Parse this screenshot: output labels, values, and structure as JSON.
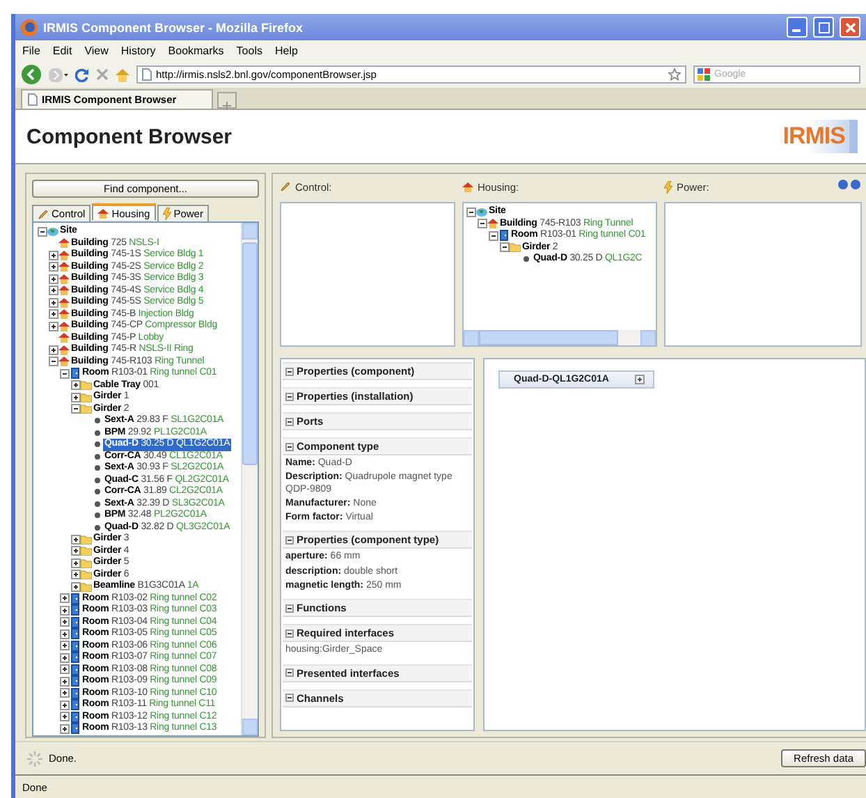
{
  "window": {
    "title": "IRMIS Component Browser - Mozilla Firefox"
  },
  "menu": [
    "File",
    "Edit",
    "View",
    "History",
    "Bookmarks",
    "Tools",
    "Help"
  ],
  "address_bar": {
    "url": "http://irmis.nsls2.bnl.gov/componentBrowser.jsp"
  },
  "search": {
    "placeholder": "Google"
  },
  "browser_tabs": [
    {
      "label": "IRMIS Component Browser",
      "selected": true
    }
  ],
  "page": {
    "title": "Component Browser",
    "logo": "IRMIS"
  },
  "find_button": "Find component...",
  "tree_tabs": [
    {
      "label": "Control",
      "kind": "control",
      "selected": false
    },
    {
      "label": "Housing",
      "kind": "housing",
      "selected": true
    },
    {
      "label": "Power",
      "kind": "power",
      "selected": false
    }
  ],
  "tree": [
    {
      "kind": "site",
      "type": "Site",
      "expanded": true,
      "selected": false,
      "children": [
        {
          "kind": "building",
          "type": "Building",
          "number": "725",
          "detail": "NSLS-I",
          "selected": false
        },
        {
          "kind": "building",
          "type": "Building",
          "number": "745-1S",
          "detail": "Service Bldg 1",
          "expanded": false,
          "selected": false
        },
        {
          "kind": "building",
          "type": "Building",
          "number": "745-2S",
          "detail": "Service Bdlg 2",
          "expanded": false,
          "selected": false
        },
        {
          "kind": "building",
          "type": "Building",
          "number": "745-3S",
          "detail": "Service Bdlg 3",
          "expanded": false,
          "selected": false
        },
        {
          "kind": "building",
          "type": "Building",
          "number": "745-4S",
          "detail": "Service Bdlg 4",
          "expanded": false,
          "selected": false
        },
        {
          "kind": "building",
          "type": "Building",
          "number": "745-5S",
          "detail": "Service Bdlg 5",
          "expanded": false,
          "selected": false
        },
        {
          "kind": "building",
          "type": "Building",
          "number": "745-B",
          "detail": "Injection Bldg",
          "expanded": false,
          "selected": false
        },
        {
          "kind": "building",
          "type": "Building",
          "number": "745-CP",
          "detail": "Compressor Bldg",
          "expanded": false,
          "selected": false
        },
        {
          "kind": "building",
          "type": "Building",
          "number": "745-P",
          "detail": "Lobby",
          "selected": false
        },
        {
          "kind": "building",
          "type": "Building",
          "number": "745-R",
          "detail": "NSLS-II Ring",
          "expanded": false,
          "selected": false
        },
        {
          "kind": "building",
          "type": "Building",
          "number": "745-R103",
          "detail": "Ring Tunnel",
          "expanded": true,
          "selected": false,
          "children": [
            {
              "kind": "room",
              "type": "Room",
              "number": "R103-01",
              "detail": "Ring tunnel C01",
              "expanded": true,
              "selected": false,
              "children": [
                {
                  "kind": "folder",
                  "type": "Cable Tray",
                  "number": "001",
                  "expanded": false,
                  "selected": false
                },
                {
                  "kind": "folder",
                  "type": "Girder",
                  "number": "1",
                  "expanded": false,
                  "selected": false
                },
                {
                  "kind": "folder",
                  "type": "Girder",
                  "number": "2",
                  "expanded": true,
                  "selected": false,
                  "children": [
                    {
                      "kind": "device",
                      "type": "Sext-A",
                      "number": "29.83 F",
                      "detail": "SL1G2C01A",
                      "selected": false
                    },
                    {
                      "kind": "device",
                      "type": "BPM",
                      "number": "29.92",
                      "detail": "PL1G2C01A",
                      "selected": false
                    },
                    {
                      "kind": "device",
                      "type": "Quad-D",
                      "number": "30.25 D",
                      "detail": "QL1G2C01A",
                      "selected": true
                    },
                    {
                      "kind": "device",
                      "type": "Corr-CA",
                      "number": "30.49",
                      "detail": "CL1G2C01A",
                      "selected": false
                    },
                    {
                      "kind": "device",
                      "type": "Sext-A",
                      "number": "30.93 F",
                      "detail": "SL2G2C01A",
                      "selected": false
                    },
                    {
                      "kind": "device",
                      "type": "Quad-C",
                      "number": "31.56 F",
                      "detail": "QL2G2C01A",
                      "selected": false
                    },
                    {
                      "kind": "device",
                      "type": "Corr-CA",
                      "number": "31.89",
                      "detail": "CL2G2C01A",
                      "selected": false
                    },
                    {
                      "kind": "device",
                      "type": "Sext-A",
                      "number": "32.39 D",
                      "detail": "SL3G2C01A",
                      "selected": false
                    },
                    {
                      "kind": "device",
                      "type": "BPM",
                      "number": "32.48",
                      "detail": "PL2G2C01A",
                      "selected": false
                    },
                    {
                      "kind": "device",
                      "type": "Quad-D",
                      "number": "32.82 D",
                      "detail": "QL3G2C01A",
                      "selected": false
                    }
                  ]
                },
                {
                  "kind": "folder",
                  "type": "Girder",
                  "number": "3",
                  "expanded": false,
                  "selected": false
                },
                {
                  "kind": "folder",
                  "type": "Girder",
                  "number": "4",
                  "expanded": false,
                  "selected": false
                },
                {
                  "kind": "folder",
                  "type": "Girder",
                  "number": "5",
                  "expanded": false,
                  "selected": false
                },
                {
                  "kind": "folder",
                  "type": "Girder",
                  "number": "6",
                  "expanded": false,
                  "selected": false
                },
                {
                  "kind": "folder",
                  "type": "Beamline",
                  "number": "B1G3C01A",
                  "detail": "1A",
                  "expanded": false,
                  "selected": false
                }
              ]
            },
            {
              "kind": "room",
              "type": "Room",
              "number": "R103-02",
              "detail": "Ring tunnel C02",
              "expanded": false,
              "selected": false
            },
            {
              "kind": "room",
              "type": "Room",
              "number": "R103-03",
              "detail": "Ring tunnel C03",
              "expanded": false,
              "selected": false
            },
            {
              "kind": "room",
              "type": "Room",
              "number": "R103-04",
              "detail": "Ring tunnel C04",
              "expanded": false,
              "selected": false
            },
            {
              "kind": "room",
              "type": "Room",
              "number": "R103-05",
              "detail": "Ring tunnel C05",
              "expanded": false,
              "selected": false
            },
            {
              "kind": "room",
              "type": "Room",
              "number": "R103-06",
              "detail": "Ring tunnel C06",
              "expanded": false,
              "selected": false
            },
            {
              "kind": "room",
              "type": "Room",
              "number": "R103-07",
              "detail": "Ring tunnel C07",
              "expanded": false,
              "selected": false
            },
            {
              "kind": "room",
              "type": "Room",
              "number": "R103-08",
              "detail": "Ring tunnel C08",
              "expanded": false,
              "selected": false
            },
            {
              "kind": "room",
              "type": "Room",
              "number": "R103-09",
              "detail": "Ring tunnel C09",
              "expanded": false,
              "selected": false
            },
            {
              "kind": "room",
              "type": "Room",
              "number": "R103-10",
              "detail": "Ring tunnel C10",
              "expanded": false,
              "selected": false
            },
            {
              "kind": "room",
              "type": "Room",
              "number": "R103-11",
              "detail": "Ring tunnel C11",
              "expanded": false,
              "selected": false
            },
            {
              "kind": "room",
              "type": "Room",
              "number": "R103-12",
              "detail": "Ring tunnel C12",
              "expanded": false,
              "selected": false
            },
            {
              "kind": "room",
              "type": "Room",
              "number": "R103-13",
              "detail": "Ring tunnel C13",
              "expanded": false,
              "selected": false
            }
          ]
        }
      ]
    }
  ],
  "panels": [
    {
      "kind": "control",
      "label": "Control:"
    },
    {
      "kind": "housing",
      "label": "Housing:"
    },
    {
      "kind": "power",
      "label": "Power:"
    }
  ],
  "housing_path": [
    {
      "kind": "site",
      "type": "Site",
      "expanded": true,
      "children": [
        {
          "kind": "building",
          "type": "Building",
          "number": "745-R103",
          "detail": "Ring Tunnel",
          "expanded": true,
          "children": [
            {
              "kind": "room",
              "type": "Room",
              "number": "R103-01",
              "detail": "Ring tunnel C01",
              "expanded": true,
              "children": [
                {
                  "kind": "folder",
                  "type": "Girder",
                  "number": "2",
                  "expanded": true,
                  "children": [
                    {
                      "kind": "device",
                      "type": "Quad-D",
                      "number": "30.25 D",
                      "detail": "QL1G2C"
                    }
                  ]
                }
              ]
            }
          ]
        }
      ]
    }
  ],
  "properties": [
    {
      "title": "Properties (component)",
      "expanded": true
    },
    {
      "title": "Properties (installation)",
      "expanded": true
    },
    {
      "title": "Ports",
      "expanded": true
    },
    {
      "title": "Component type",
      "expanded": true,
      "items": [
        {
          "label": "Name:",
          "value": "Quad-D"
        },
        {
          "label": "Description:",
          "value": "Quadrupole magnet type QDP-9809"
        },
        {
          "label": "Manufacturer:",
          "value": "None"
        },
        {
          "label": "Form factor:",
          "value": "Virtual"
        }
      ]
    },
    {
      "title": "Properties (component type)",
      "expanded": true,
      "items": [
        {
          "label": "aperture:",
          "value": "66 mm"
        },
        {
          "label": "description:",
          "value": "double short"
        },
        {
          "label": "magnetic length:",
          "value": "250 mm"
        }
      ]
    },
    {
      "title": "Functions",
      "expanded": true
    },
    {
      "title": "Required interfaces",
      "expanded": true,
      "items": [
        {
          "value": "housing:Girder_Space"
        }
      ]
    },
    {
      "title": "Presented interfaces",
      "expanded": true
    },
    {
      "title": "Channels",
      "expanded": true
    }
  ],
  "diagram": {
    "node": "Quad-D-QL1G2C01A"
  },
  "status": "Done.",
  "refresh_button": "Refresh data",
  "browser_status": "Done"
}
